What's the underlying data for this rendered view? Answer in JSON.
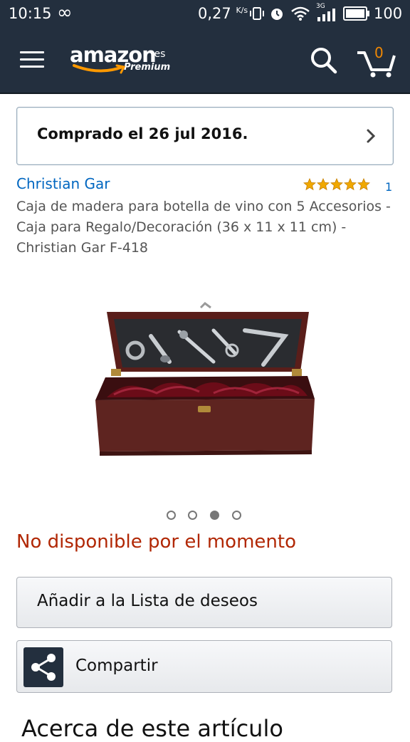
{
  "status_bar": {
    "time": "10:15",
    "loop_glyph": "∞",
    "speed": "0,27",
    "speed_unit": "K/s",
    "network": "3G",
    "battery": "100"
  },
  "header": {
    "logo_text": "amazon",
    "logo_tld": ".es",
    "logo_premium": "Premium",
    "cart_count": "0",
    "icons": [
      "menu-icon",
      "search-icon",
      "cart-icon"
    ]
  },
  "purchase_notice": {
    "text": "Comprado el 26 jul 2016."
  },
  "product": {
    "brand": "Christian Gar",
    "rating_stars": 5,
    "rating_count": "1",
    "title": "Caja de madera para botella de vino con 5 Accesorios - Caja para Regalo/Decoración (36 x 11 x 11 cm) - Christian Gar F-418",
    "image_pagination": {
      "total": 4,
      "active": 3
    },
    "availability": "No disponible por el momento"
  },
  "actions": {
    "wishlist_label": "Añadir a la Lista de deseos",
    "share_label": "Compartir"
  },
  "section_heading": "Acerca de este artículo",
  "colors": {
    "header_bg": "#232f3e",
    "link": "#0066c0",
    "availability": "#b12704",
    "star": "#f0a800",
    "cart_accent": "#f08804"
  }
}
